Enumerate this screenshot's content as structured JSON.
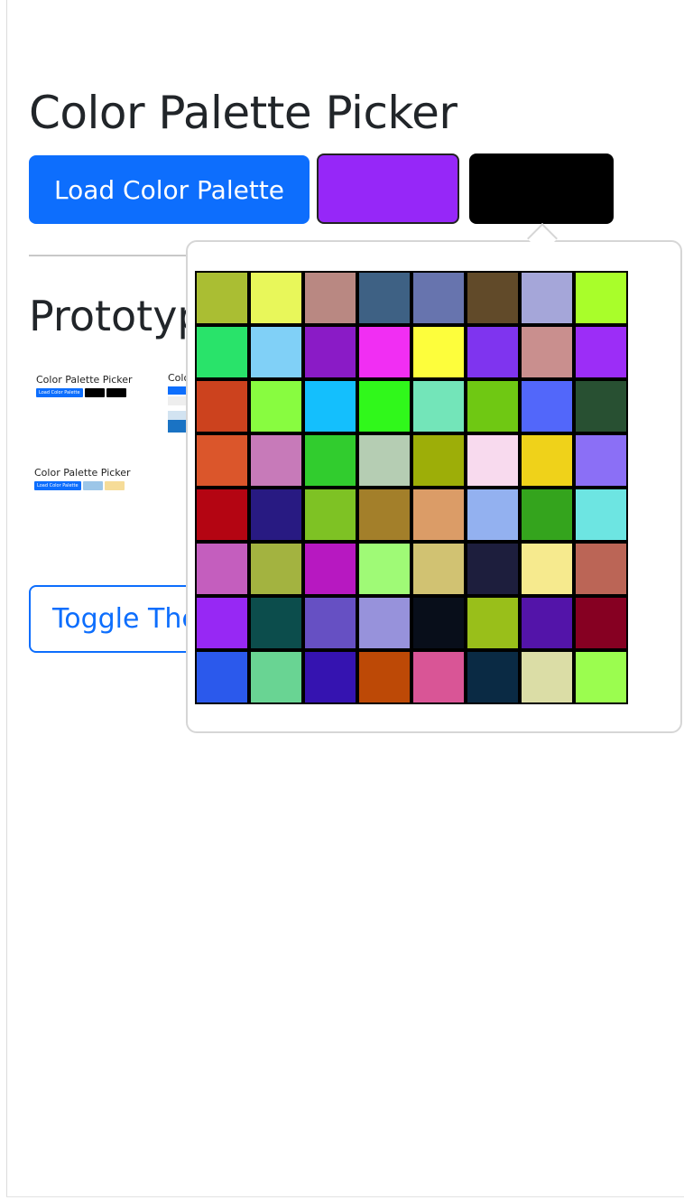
{
  "title": "Color Palette Picker",
  "load_button_label": "Load Color Palette",
  "swatches": [
    {
      "name": "selected-color-1",
      "color": "#9627f8"
    },
    {
      "name": "selected-color-2",
      "color": "#000000"
    }
  ],
  "prototypes": {
    "heading": "Prototypes",
    "thumbnails": [
      {
        "title": "Color Palette Picker",
        "button_label": "Load Color Palette",
        "swatch_colors": [
          "#000000",
          "#000000"
        ]
      },
      {
        "title": "Color Palette Picker",
        "button_label": "Load Color Palette",
        "swatch_colors": [
          "#9cc6e8",
          "#f6dc98"
        ]
      }
    ]
  },
  "toggle_button_label": "Toggle Theme",
  "palette_colors": [
    "#aabe33",
    "#e8f75a",
    "#b98882",
    "#3e6184",
    "#6774ae",
    "#614a29",
    "#a5a6d9",
    "#a9fe2a",
    "#29e36a",
    "#80d0f7",
    "#8a1bc6",
    "#f12ef3",
    "#fdfe3c",
    "#7f34ef",
    "#c98f8e",
    "#9c2df7",
    "#cc421e",
    "#88fc40",
    "#14bffd",
    "#30f81b",
    "#73e5b9",
    "#6fc813",
    "#5267fa",
    "#285032",
    "#db562b",
    "#c77ab9",
    "#31cc2e",
    "#b5cdb3",
    "#9dae08",
    "#f8daee",
    "#efd21a",
    "#8b6ff6",
    "#b40512",
    "#281a82",
    "#7ec224",
    "#a37f2a",
    "#db9c67",
    "#93b1f0",
    "#34a41d",
    "#6de5e2",
    "#c45ebe",
    "#a3b340",
    "#b718c1",
    "#9ffa76",
    "#d1c272",
    "#1d1e3d",
    "#f6ea8e",
    "#bb6556",
    "#9728f4",
    "#0c4d4c",
    "#6650c3",
    "#9792db",
    "#080e1a",
    "#99bf1a",
    "#5314a9",
    "#860022",
    "#2b59ec",
    "#69d493",
    "#3513b0",
    "#bd4906",
    "#d95596",
    "#0a2a44",
    "#dbdda6",
    "#9bfd4f"
  ]
}
